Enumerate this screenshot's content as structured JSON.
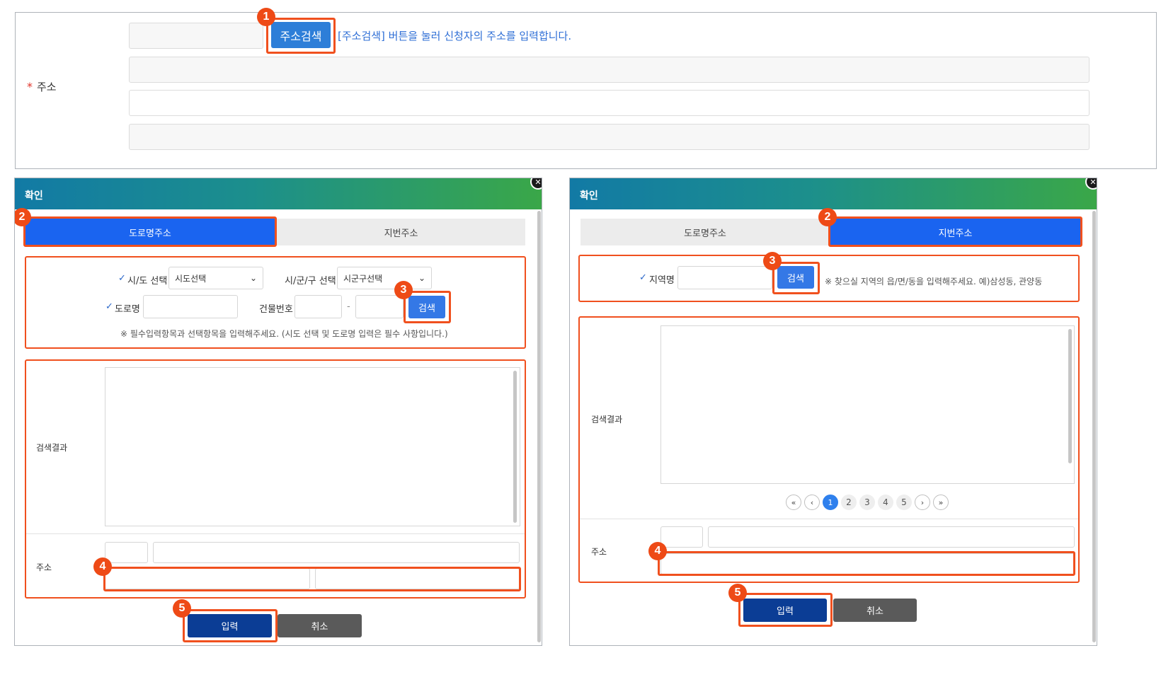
{
  "top_form": {
    "required_mark": "*",
    "address_label": "주소",
    "search_button": "주소검색",
    "hint": "[주소검색] 버튼을 눌러 신청자의 주소를 입력합니다."
  },
  "road_dialog": {
    "title": "확인",
    "tabs": [
      "도로명주소",
      "지번주소"
    ],
    "sido_label": "시/도 선택",
    "sido_value": "시도선택",
    "sigungu_label": "시/군/구 선택",
    "sigungu_value": "시군구선택",
    "road_label": "도로명",
    "building_label": "건물번호",
    "dash": "-",
    "search_button": "검색",
    "notice": "※ 필수입력항목과 선택항목을 입력해주세요. (시도 선택 및 도로명 입력은 필수 사항입니다.)",
    "results_label": "검색결과",
    "address_label": "주소",
    "ok_button": "입력",
    "cancel_button": "취소"
  },
  "lot_dialog": {
    "title": "확인",
    "tabs": [
      "도로명주소",
      "지번주소"
    ],
    "area_label": "지역명",
    "search_button": "검색",
    "notice": "※ 찾으실 지역의 읍/면/동을 입력해주세요. 예)삼성동, 관양동",
    "results_label": "검색결과",
    "pagination": {
      "first": "«",
      "prev": "‹",
      "pages": [
        "1",
        "2",
        "3",
        "4",
        "5"
      ],
      "next": "›",
      "last": "»",
      "current": "1"
    },
    "address_label": "주소",
    "ok_button": "입력",
    "cancel_button": "취소"
  },
  "badges": [
    "1",
    "2",
    "3",
    "4",
    "5"
  ],
  "icons": {
    "check": "check-icon",
    "dropdown": "chevron-down-icon",
    "close": "close-icon"
  },
  "colors": {
    "annotation": "#f0501e",
    "active_tab": "#1a64f0",
    "primary_button": "#0b3d95",
    "header_start": "#127aa5",
    "header_end": "#3aa748"
  }
}
